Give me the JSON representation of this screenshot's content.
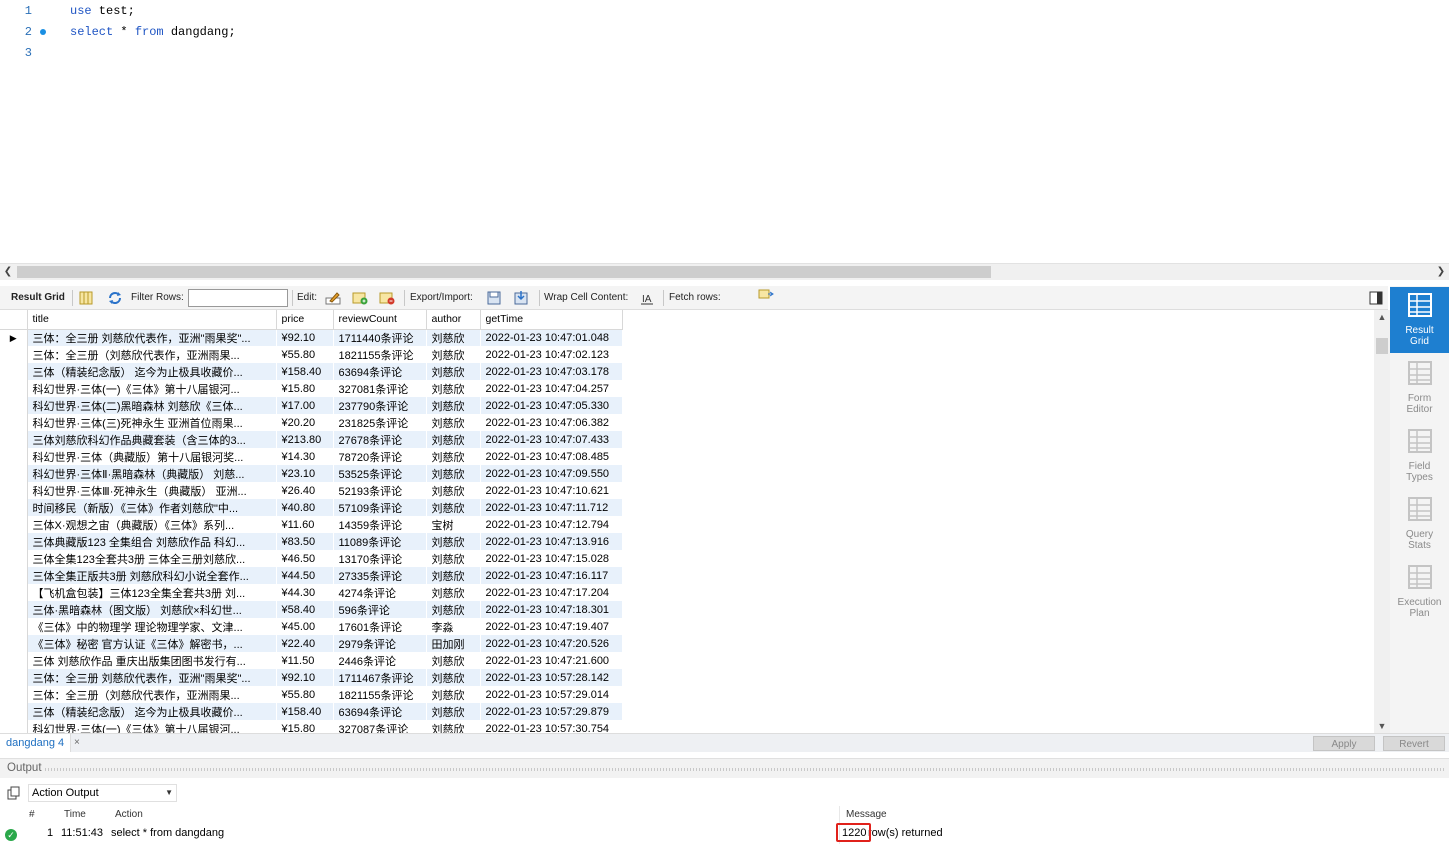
{
  "editor": {
    "lines": [
      {
        "num": "1",
        "kw1": "use",
        "rest1": " test;",
        "kw2": "",
        "rest2": "",
        "dot": false
      },
      {
        "num": "2",
        "kw1": "select",
        "rest1": " * ",
        "kw2": "from",
        "rest2": " dangdang;",
        "dot": true
      },
      {
        "num": "3",
        "kw1": "",
        "rest1": "",
        "kw2": "",
        "rest2": "",
        "dot": false
      }
    ]
  },
  "toolbar": {
    "result_grid": "Result Grid",
    "filter_rows": "Filter Rows:",
    "filter_value": "",
    "edit": "Edit:",
    "export_import": "Export/Import:",
    "wrap_cell": "Wrap Cell Content:",
    "fetch_rows": "Fetch rows:"
  },
  "side_panel": [
    {
      "label": "Result Grid",
      "line1": "Result",
      "line2": "Grid",
      "active": true
    },
    {
      "label": "Form Editor",
      "line1": "Form",
      "line2": "Editor",
      "active": false
    },
    {
      "label": "Field Types",
      "line1": "Field",
      "line2": "Types",
      "active": false
    },
    {
      "label": "Query Stats",
      "line1": "Query",
      "line2": "Stats",
      "active": false
    },
    {
      "label": "Execution Plan",
      "line1": "Execution",
      "line2": "Plan",
      "active": false
    }
  ],
  "grid": {
    "columns": [
      "title",
      "price",
      "reviewCount",
      "author",
      "getTime"
    ],
    "rows": [
      [
        "三体：全三册 刘慈欣代表作，亚洲\"雨果奖\"...",
        "¥92.10",
        "1711440条评论",
        "刘慈欣",
        "2022-01-23 10:47:01.048"
      ],
      [
        "三体：全三册（刘慈欣代表作，亚洲雨果...",
        "¥55.80",
        "1821155条评论",
        "刘慈欣",
        "2022-01-23 10:47:02.123"
      ],
      [
        "三体（精装纪念版） 迄今为止极具收藏价...",
        "¥158.40",
        "63694条评论",
        "刘慈欣",
        "2022-01-23 10:47:03.178"
      ],
      [
        "科幻世界·三体(一)《三体》第十八届银河...",
        "¥15.80",
        "327081条评论",
        "刘慈欣",
        "2022-01-23 10:47:04.257"
      ],
      [
        "科幻世界·三体(二)黑暗森林 刘慈欣《三体...",
        "¥17.00",
        "237790条评论",
        "刘慈欣",
        "2022-01-23 10:47:05.330"
      ],
      [
        "科幻世界·三体(三)死神永生 亚洲首位雨果...",
        "¥20.20",
        "231825条评论",
        "刘慈欣",
        "2022-01-23 10:47:06.382"
      ],
      [
        "三体刘慈欣科幻作品典藏套装（含三体的3...",
        "¥213.80",
        "27678条评论",
        "刘慈欣",
        "2022-01-23 10:47:07.433"
      ],
      [
        "科幻世界·三体（典藏版）第十八届银河奖...",
        "¥14.30",
        "78720条评论",
        "刘慈欣",
        "2022-01-23 10:47:08.485"
      ],
      [
        "科幻世界·三体Ⅱ·黑暗森林（典藏版） 刘慈...",
        "¥23.10",
        "53525条评论",
        "刘慈欣",
        "2022-01-23 10:47:09.550"
      ],
      [
        "科幻世界·三体Ⅲ·死神永生（典藏版） 亚洲...",
        "¥26.40",
        "52193条评论",
        "刘慈欣",
        "2022-01-23 10:47:10.621"
      ],
      [
        "时间移民（新版）《三体》作者刘慈欣\"中...",
        "¥40.80",
        "57109条评论",
        "刘慈欣",
        "2022-01-23 10:47:11.712"
      ],
      [
        "三体X·观想之宙（典藏版）《三体》系列...",
        "¥11.60",
        "14359条评论",
        "宝树",
        "2022-01-23 10:47:12.794"
      ],
      [
        "三体典藏版123 全集组合 刘慈欣作品 科幻...",
        "¥83.50",
        "11089条评论",
        "刘慈欣",
        "2022-01-23 10:47:13.916"
      ],
      [
        "三体全集123全套共3册 三体全三册刘慈欣...",
        "¥46.50",
        "13170条评论",
        "刘慈欣",
        "2022-01-23 10:47:15.028"
      ],
      [
        "三体全集正版共3册 刘慈欣科幻小说全套作...",
        "¥44.50",
        "27335条评论",
        "刘慈欣",
        "2022-01-23 10:47:16.117"
      ],
      [
        "【飞机盒包装】三体123全集全套共3册 刘...",
        "¥44.30",
        "4274条评论",
        "刘慈欣",
        "2022-01-23 10:47:17.204"
      ],
      [
        "三体·黑暗森林（图文版） 刘慈欣×科幻世...",
        "¥58.40",
        "596条评论",
        "刘慈欣",
        "2022-01-23 10:47:18.301"
      ],
      [
        "《三体》中的物理学 理论物理学家、文津...",
        "¥45.00",
        "17601条评论",
        "李淼",
        "2022-01-23 10:47:19.407"
      ],
      [
        "《三体》秘密 官方认证《三体》解密书，...",
        "¥22.40",
        "2979条评论",
        "田加刚",
        "2022-01-23 10:47:20.526"
      ],
      [
        "三体 刘慈欣作品 重庆出版集团图书发行有...",
        "¥11.50",
        "2446条评论",
        "刘慈欣",
        "2022-01-23 10:47:21.600"
      ],
      [
        "三体：全三册 刘慈欣代表作，亚洲\"雨果奖\"...",
        "¥92.10",
        "1711467条评论",
        "刘慈欣",
        "2022-01-23 10:57:28.142"
      ],
      [
        "三体：全三册（刘慈欣代表作，亚洲雨果...",
        "¥55.80",
        "1821155条评论",
        "刘慈欣",
        "2022-01-23 10:57:29.014"
      ],
      [
        "三体（精装纪念版） 迄今为止极具收藏价...",
        "¥158.40",
        "63694条评论",
        "刘慈欣",
        "2022-01-23 10:57:29.879"
      ],
      [
        "科幻世界·三体(一)《三体》第十八届银河...",
        "¥15.80",
        "327087条评论",
        "刘慈欣",
        "2022-01-23 10:57:30.754"
      ]
    ]
  },
  "result_tab": {
    "label": "dangdang 4",
    "close": "×"
  },
  "buttons": {
    "apply": "Apply",
    "revert": "Revert"
  },
  "output": {
    "title": "Output",
    "selector": "Action Output",
    "headers": {
      "num": "#",
      "time": "Time",
      "action": "Action",
      "message": "Message"
    },
    "row": {
      "num": "1",
      "time": "11:51:43",
      "action": "select * from dangdang",
      "count": "1220",
      "message_rest": " row(s) returned"
    }
  }
}
